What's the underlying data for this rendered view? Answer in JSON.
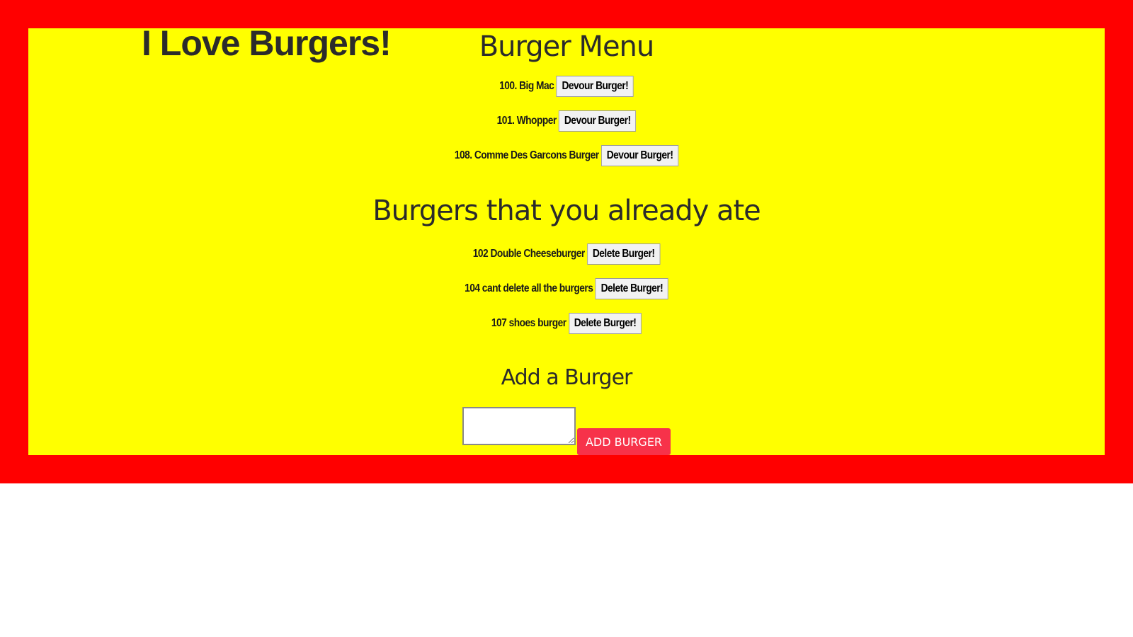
{
  "site_title": "I Love Burgers!",
  "colors": {
    "frame": "#ff0000",
    "panel": "#ffff00",
    "add_button": "#f7324a"
  },
  "menu": {
    "title": "Burger Menu",
    "button_label": "Devour Burger!",
    "items": [
      {
        "name": "100. Big Mac"
      },
      {
        "name": "101. Whopper"
      },
      {
        "name": "108. Comme Des Garcons Burger"
      }
    ]
  },
  "eaten": {
    "title": "Burgers that you already ate",
    "button_label": "Delete Burger!",
    "items": [
      {
        "name": "102 Double Cheeseburger"
      },
      {
        "name": "104 cant delete all the burgers"
      },
      {
        "name": "107 shoes burger"
      }
    ]
  },
  "add": {
    "title": "Add a Burger",
    "input_value": "",
    "button_label": "ADD BURGER"
  }
}
